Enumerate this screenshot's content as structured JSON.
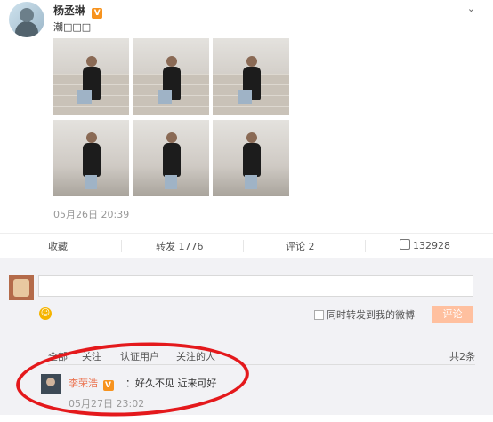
{
  "post": {
    "author": "杨丞琳",
    "caption": "潮□□□",
    "timestamp": "05月26日 20:39",
    "photos": [
      {
        "kind": "stairs"
      },
      {
        "kind": "stairs"
      },
      {
        "kind": "stairs"
      },
      {
        "kind": "standing"
      },
      {
        "kind": "standing"
      },
      {
        "kind": "standing"
      }
    ]
  },
  "actions": {
    "favorite": "收藏",
    "repost": "转发 1776",
    "comment": "评论 2",
    "like": "132928"
  },
  "composer": {
    "repost_label": "同时转发到我的微博",
    "submit": "评论"
  },
  "filters": {
    "all": "全部",
    "following": "关注",
    "verified": "认证用户",
    "followed_people": "关注的人",
    "total": "共2条"
  },
  "comment": {
    "user": "李荣浩",
    "text": "：好久不见 近来可好",
    "time": "05月27日 23:02"
  },
  "colors": {
    "accent": "#eb7350",
    "verified_badge": "#f7931e",
    "highlight_ring": "#e4191c"
  }
}
